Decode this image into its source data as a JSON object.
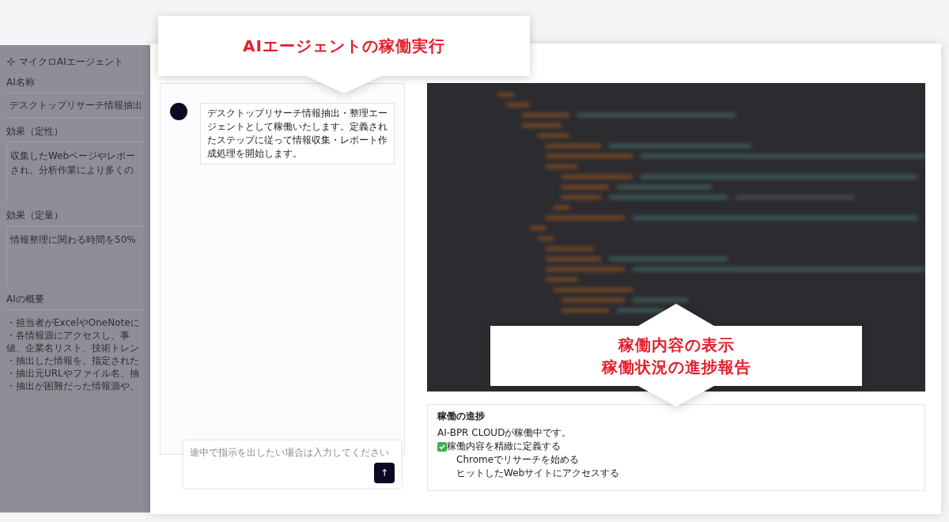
{
  "callouts": [
    {
      "lines": [
        "AIエージェントの稼働実行"
      ]
    },
    {
      "lines": [
        "稼働内容の表示",
        "稼働状況の進捗報告"
      ]
    }
  ],
  "side_panel": {
    "title": "マイクロAIエージェント",
    "fields": [
      {
        "label": "AI名称",
        "kind": "input",
        "lines": [
          "デスクトップリサーチ情報抽出"
        ]
      },
      {
        "label": "効果（定性）",
        "kind": "textarea",
        "lines": [
          "収集したWebページやレポー",
          "され、分析作業により多くの"
        ]
      },
      {
        "label": "効果（定量）",
        "kind": "textarea",
        "lines": [
          "情報整理に関わる時間を50%"
        ]
      },
      {
        "label": "AIの概要",
        "kind": "text",
        "lines": [
          "・担当者がExcelやOneNoteに",
          "・各情報源にアクセスし、事",
          "値、企業名リスト、技術トレン",
          "・抽出した情報を、指定された",
          "・抽出元URLやファイル名、抽",
          "・抽出が困難だった情報源や、"
        ]
      }
    ]
  },
  "chat": {
    "messages": [
      {
        "text": "デスクトップリサーチ情報抽出・整理エージェントとして稼働いたします。定義されたステップに従って情報収集・レポート作成処理を開始します。"
      }
    ],
    "input": {
      "placeholder": "途中で指示を出したい場合は入力してください"
    },
    "send_button": "↑"
  },
  "progress": {
    "title": "稼働の進捗",
    "lines": [
      {
        "kind": "status",
        "text": "AI-BPR CLOUDが稼働中です。"
      },
      {
        "kind": "step",
        "done": true,
        "text": "稼働内容を精緻に定義する"
      },
      {
        "kind": "step",
        "done": false,
        "text": "Chromeでリサーチを始める"
      },
      {
        "kind": "step",
        "done": false,
        "text": "ヒットしたWebサイトにアクセスする"
      }
    ]
  }
}
